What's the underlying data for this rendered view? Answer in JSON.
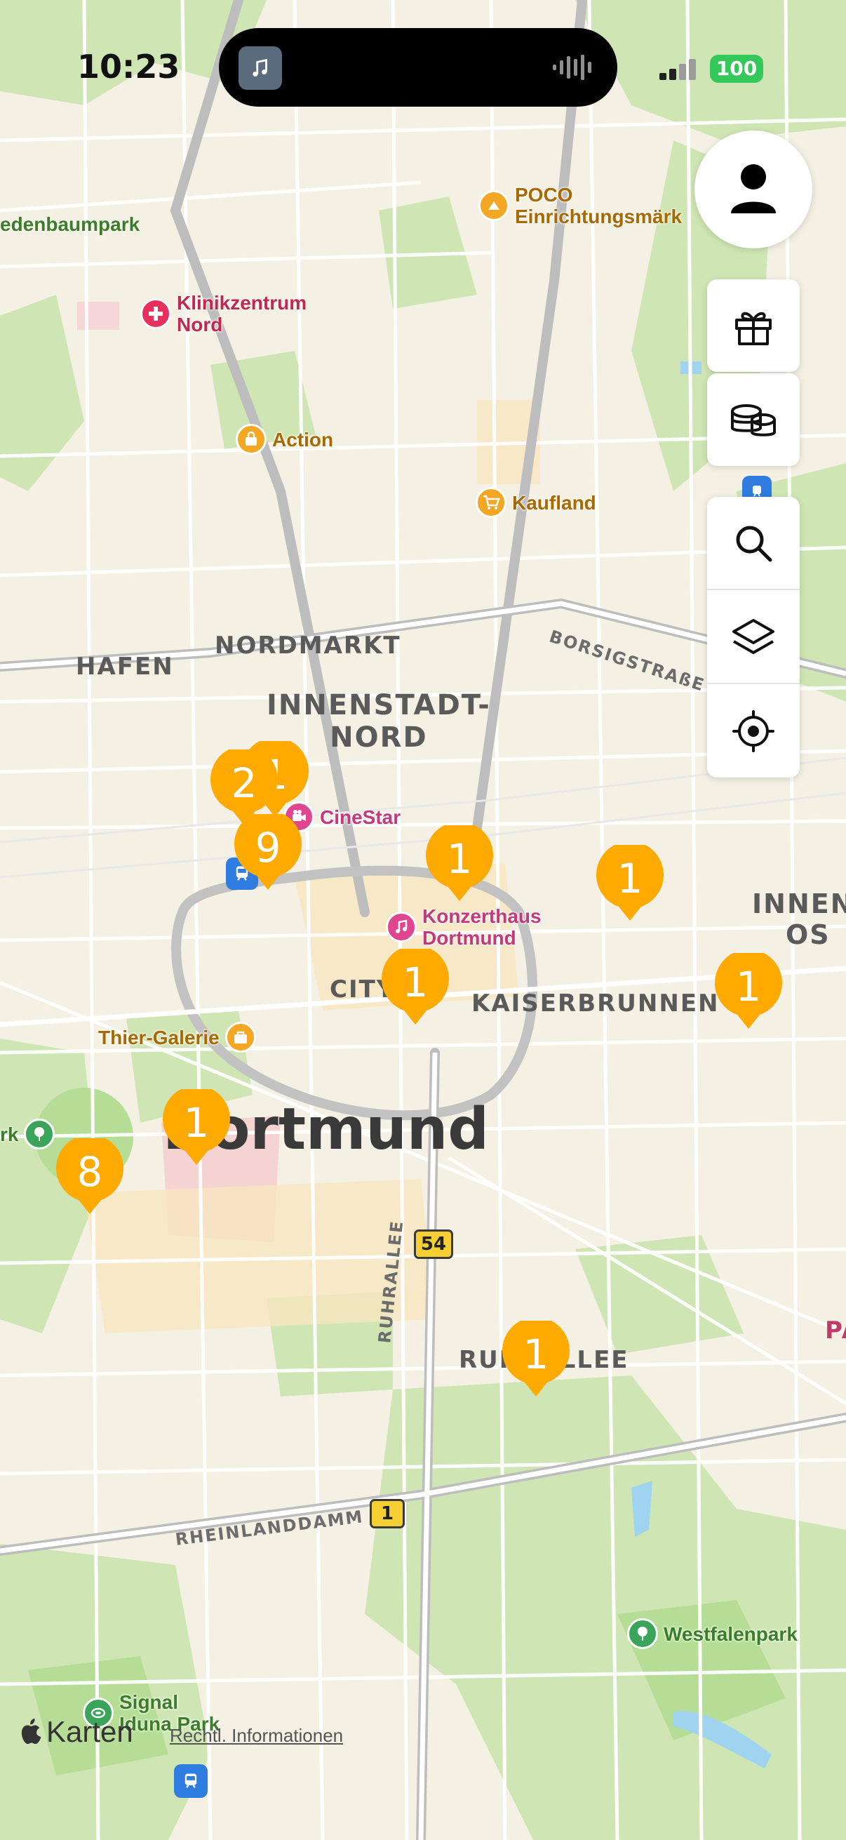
{
  "status_bar": {
    "time": "10:23",
    "battery": "100"
  },
  "districts": {
    "hafen": "HAFEN",
    "nordmarkt": "NORDMARKT",
    "innenstadt_nord_1": "INNENSTADT-",
    "innenstadt_nord_2": "NORD",
    "city": "CITY",
    "kaiserbrunnen": "KAISERBRUNNEN",
    "city_name": "Dortmund",
    "innenstadt_ost_1": "INNENS",
    "innenstadt_ost_2": "OS",
    "ruhrallee_area": "RUHRALLEE",
    "edge_p": "PA"
  },
  "roads": {
    "borsigstrasse": "BORSIGSTRAßE",
    "ruhrallee": "RUHRALLEE",
    "rheinlanddamm": "RHEINLANDDAMM",
    "b54": "54",
    "b1": "1"
  },
  "pois": {
    "friedenbaumpark": "edenbaumpark",
    "klinikzentrum_1": "Klinikzentrum",
    "klinikzentrum_2": "Nord",
    "poco_1": "POCO",
    "poco_2": "Einrichtungsmärk",
    "action": "Action",
    "kaufland": "Kaufland",
    "cinestar": "CineStar",
    "konzerthaus_1": "Konzerthaus",
    "konzerthaus_2": "Dortmund",
    "thier_galerie": "Thier-Galerie",
    "park_left": "rk",
    "westfalenpark": "Westfalenpark",
    "signal_1": "Signal",
    "signal_2": "Iduna Park"
  },
  "markers": {
    "m_hidden": "1",
    "m_2": "2",
    "m_9": "9",
    "m_konzert": "1",
    "m_east": "1",
    "m_city": "1",
    "m_far_east": "1",
    "m_dortmund": "1",
    "m_8": "8",
    "m_south": "1"
  },
  "footer": {
    "brand": "Karten",
    "legal": "Rechtl. Informationen"
  },
  "colors": {
    "marker": "#ffaa00",
    "park": "#c3e3a6",
    "road_major": "#b8b8b8",
    "water": "#9fd3f0",
    "land": "#f3efe3"
  }
}
